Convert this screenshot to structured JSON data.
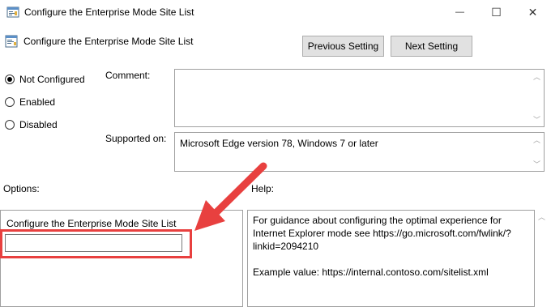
{
  "window": {
    "title": "Configure the Enterprise Mode Site List",
    "minimize_glyph": "—",
    "maximize_glyph": "☐",
    "close_glyph": "✕"
  },
  "header": {
    "policy_title": "Configure the Enterprise Mode Site List",
    "previous_label": "Previous Setting",
    "next_label": "Next Setting"
  },
  "state": {
    "options": [
      {
        "label": "Not Configured",
        "checked": true
      },
      {
        "label": "Enabled",
        "checked": false
      },
      {
        "label": "Disabled",
        "checked": false
      }
    ]
  },
  "comment": {
    "label": "Comment:",
    "value": ""
  },
  "supported": {
    "label": "Supported on:",
    "value": "Microsoft Edge version 78, Windows 7 or later"
  },
  "options_section": {
    "label": "Options:",
    "field_label": "Configure the Enterprise Mode Site List",
    "field_value": ""
  },
  "help_section": {
    "label": "Help:",
    "line1": "For guidance about configuring the optimal experience for",
    "line2": "Internet Explorer mode see https://go.microsoft.com/fwlink/?",
    "line3": "linkid=2094210",
    "line4": "Example value: https://internal.contoso.com/sitelist.xml"
  },
  "annotation": {
    "color": "#e8403f"
  }
}
